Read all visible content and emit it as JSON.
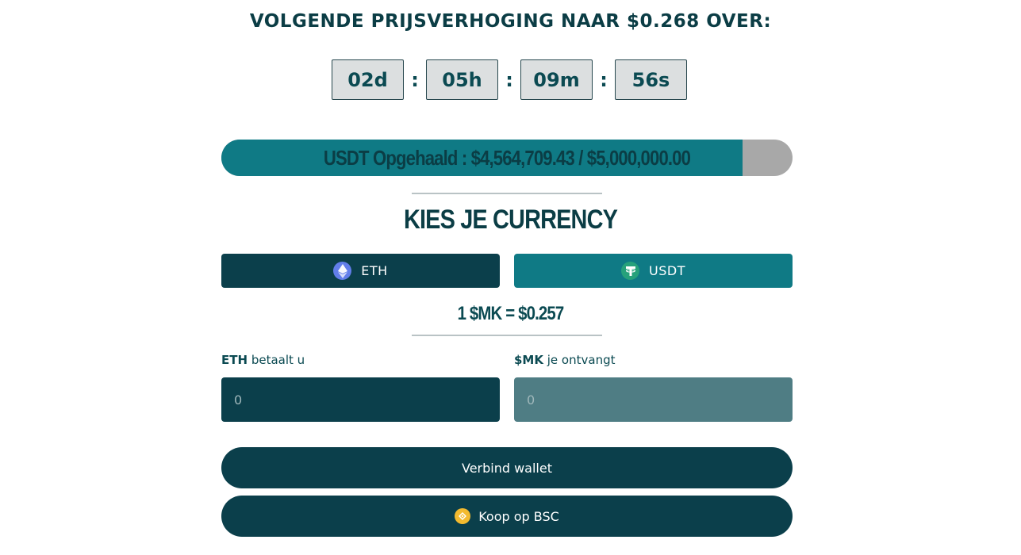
{
  "headline": "VOLGENDE PRIJSVERHOGING NAAR $0.268 OVER:",
  "timer": {
    "days": "02d",
    "hours": "05h",
    "minutes": "09m",
    "seconds": "56s",
    "separator": ":"
  },
  "progress": {
    "text": "USDT Opgehaald : $4,564,709.43 / $5,000,000.00",
    "raised": 4564709.43,
    "goal": 5000000.0,
    "fill_color": "#0f7a85",
    "track_color": "#a8a8a8"
  },
  "currency_section": {
    "title": "KIES JE CURRENCY",
    "options": [
      {
        "label": "ETH",
        "icon": "ethereum-icon",
        "selected": true
      },
      {
        "label": "USDT",
        "icon": "tether-icon",
        "selected": false
      }
    ]
  },
  "rate": "1 $MK = $0.257",
  "form": {
    "pay_label_bold": "ETH",
    "pay_label_rest": " betaalt u",
    "pay_placeholder": "0",
    "receive_label_bold": "$MK",
    "receive_label_rest": " je ontvangt",
    "receive_placeholder": "0"
  },
  "buttons": {
    "connect": "Verbind wallet",
    "buy_bsc": "Koop op BSC",
    "buy_bsc_icon": "bnb-icon"
  },
  "colors": {
    "primary_dark": "#0b3f4b",
    "accent": "#0f7a85",
    "text": "#0b4a52"
  }
}
